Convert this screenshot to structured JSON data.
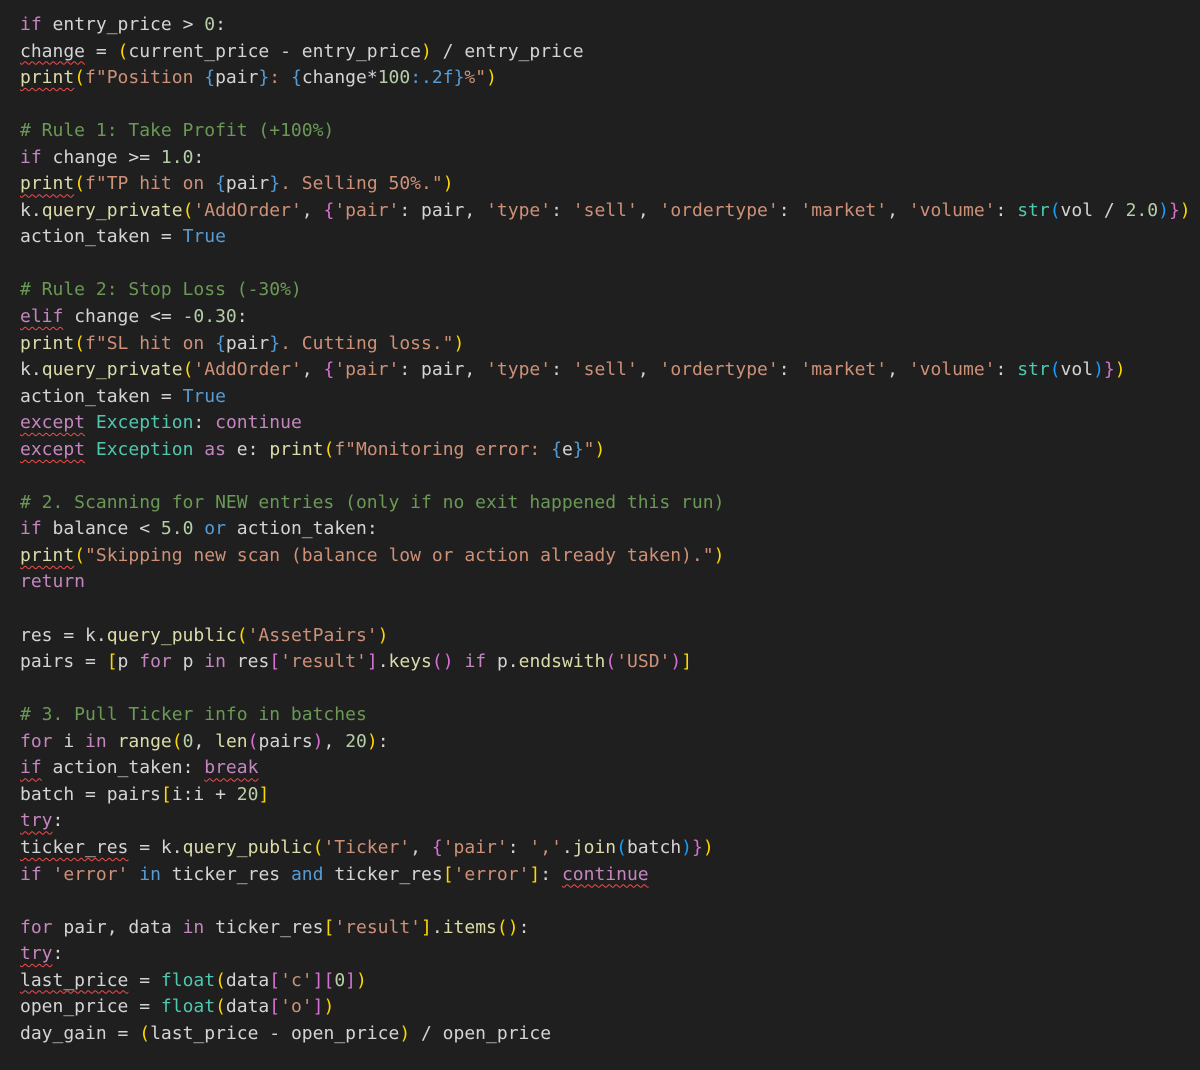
{
  "theme": {
    "background": "#1f1f1f",
    "colors": {
      "text": "#d4d4d4",
      "keyword": "#c586c0",
      "function": "#dcdcaa",
      "string": "#ce9178",
      "number": "#b5cea8",
      "comment": "#6a9955",
      "constant": "#569cd6",
      "type": "#4ec9b0",
      "bracket1": "#ffd700",
      "bracket2": "#da70d6",
      "bracket3": "#179fff",
      "error_squiggle": "#f14c4c"
    }
  },
  "code_lines": [
    [
      [
        "if",
        "keyword"
      ],
      [
        " entry_price > ",
        "text"
      ],
      [
        "0",
        "number"
      ],
      [
        ":",
        "text"
      ]
    ],
    [
      [
        "change",
        "text",
        1
      ],
      [
        " = ",
        "text"
      ],
      [
        "(",
        "bracket1"
      ],
      [
        "current_price - entry_price",
        "text"
      ],
      [
        ")",
        "bracket1"
      ],
      [
        " / entry_price",
        "text"
      ]
    ],
    [
      [
        "print",
        "function",
        1
      ],
      [
        "(",
        "bracket1"
      ],
      [
        "f\"Position ",
        "string"
      ],
      [
        "{",
        "constant"
      ],
      [
        "pair",
        "text"
      ],
      [
        "}",
        "constant"
      ],
      [
        ": ",
        "string"
      ],
      [
        "{",
        "constant"
      ],
      [
        "change*",
        "text"
      ],
      [
        "100",
        "number"
      ],
      [
        ":.2f",
        "constant"
      ],
      [
        "}",
        "constant"
      ],
      [
        "%\"",
        "string"
      ],
      [
        ")",
        "bracket1"
      ]
    ],
    [],
    [
      [
        "# Rule 1: Take Profit (+100%)",
        "comment"
      ]
    ],
    [
      [
        "if",
        "keyword"
      ],
      [
        " change >= ",
        "text"
      ],
      [
        "1.0",
        "number"
      ],
      [
        ":",
        "text"
      ]
    ],
    [
      [
        "print",
        "function",
        1
      ],
      [
        "(",
        "bracket1"
      ],
      [
        "f\"TP hit on ",
        "string"
      ],
      [
        "{",
        "constant"
      ],
      [
        "pair",
        "text"
      ],
      [
        "}",
        "constant"
      ],
      [
        ". Selling 50%.\"",
        "string"
      ],
      [
        ")",
        "bracket1"
      ]
    ],
    [
      [
        "k.",
        "text"
      ],
      [
        "query_private",
        "function"
      ],
      [
        "(",
        "bracket1"
      ],
      [
        "'AddOrder'",
        "string"
      ],
      [
        ", ",
        "text"
      ],
      [
        "{",
        "bracket2"
      ],
      [
        "'pair'",
        "string"
      ],
      [
        ": pair, ",
        "text"
      ],
      [
        "'type'",
        "string"
      ],
      [
        ": ",
        "text"
      ],
      [
        "'sell'",
        "string"
      ],
      [
        ", ",
        "text"
      ],
      [
        "'ordertype'",
        "string"
      ],
      [
        ": ",
        "text"
      ],
      [
        "'market'",
        "string"
      ],
      [
        ", ",
        "text"
      ],
      [
        "'volume'",
        "string"
      ],
      [
        ": ",
        "text"
      ],
      [
        "str",
        "type"
      ],
      [
        "(",
        "bracket3"
      ],
      [
        "vol / ",
        "text"
      ],
      [
        "2.0",
        "number"
      ],
      [
        ")",
        "bracket3"
      ],
      [
        "}",
        "bracket2"
      ],
      [
        ")",
        "bracket1"
      ]
    ],
    [
      [
        "action_taken = ",
        "text"
      ],
      [
        "True",
        "constant"
      ]
    ],
    [],
    [
      [
        "# Rule 2: Stop Loss (-30%)",
        "comment"
      ]
    ],
    [
      [
        "elif",
        "keyword",
        1
      ],
      [
        " change <= ",
        "text"
      ],
      [
        "-0.30",
        "number"
      ],
      [
        ":",
        "text"
      ]
    ],
    [
      [
        "print",
        "function"
      ],
      [
        "(",
        "bracket1"
      ],
      [
        "f\"SL hit on ",
        "string"
      ],
      [
        "{",
        "constant"
      ],
      [
        "pair",
        "text"
      ],
      [
        "}",
        "constant"
      ],
      [
        ". Cutting loss.\"",
        "string"
      ],
      [
        ")",
        "bracket1"
      ]
    ],
    [
      [
        "k.",
        "text"
      ],
      [
        "query_private",
        "function"
      ],
      [
        "(",
        "bracket1"
      ],
      [
        "'AddOrder'",
        "string"
      ],
      [
        ", ",
        "text"
      ],
      [
        "{",
        "bracket2"
      ],
      [
        "'pair'",
        "string"
      ],
      [
        ": pair, ",
        "text"
      ],
      [
        "'type'",
        "string"
      ],
      [
        ": ",
        "text"
      ],
      [
        "'sell'",
        "string"
      ],
      [
        ", ",
        "text"
      ],
      [
        "'ordertype'",
        "string"
      ],
      [
        ": ",
        "text"
      ],
      [
        "'market'",
        "string"
      ],
      [
        ", ",
        "text"
      ],
      [
        "'volume'",
        "string"
      ],
      [
        ": ",
        "text"
      ],
      [
        "str",
        "type"
      ],
      [
        "(",
        "bracket3"
      ],
      [
        "vol",
        "text"
      ],
      [
        ")",
        "bracket3"
      ],
      [
        "}",
        "bracket2"
      ],
      [
        ")",
        "bracket1"
      ]
    ],
    [
      [
        "action_taken = ",
        "text"
      ],
      [
        "True",
        "constant"
      ]
    ],
    [
      [
        "except",
        "keyword",
        1
      ],
      [
        " ",
        "text"
      ],
      [
        "Exception",
        "type"
      ],
      [
        ": ",
        "text"
      ],
      [
        "continue",
        "keyword"
      ]
    ],
    [
      [
        "except",
        "keyword",
        1
      ],
      [
        " ",
        "text"
      ],
      [
        "Exception",
        "type"
      ],
      [
        " ",
        "text"
      ],
      [
        "as",
        "keyword"
      ],
      [
        " e: ",
        "text"
      ],
      [
        "print",
        "function"
      ],
      [
        "(",
        "bracket1"
      ],
      [
        "f\"Monitoring error: ",
        "string"
      ],
      [
        "{",
        "constant"
      ],
      [
        "e",
        "text"
      ],
      [
        "}",
        "constant"
      ],
      [
        "\"",
        "string"
      ],
      [
        ")",
        "bracket1"
      ]
    ],
    [],
    [
      [
        "# 2. Scanning for NEW entries (only if no exit happened this run)",
        "comment"
      ]
    ],
    [
      [
        "if",
        "keyword"
      ],
      [
        " balance < ",
        "text"
      ],
      [
        "5.0",
        "number"
      ],
      [
        " ",
        "text"
      ],
      [
        "or",
        "constant"
      ],
      [
        " action_taken:",
        "text"
      ]
    ],
    [
      [
        "print",
        "function",
        1
      ],
      [
        "(",
        "bracket1"
      ],
      [
        "\"Skipping new scan (balance low or action already taken).\"",
        "string"
      ],
      [
        ")",
        "bracket1"
      ]
    ],
    [
      [
        "return",
        "keyword"
      ]
    ],
    [],
    [
      [
        "res = k.",
        "text"
      ],
      [
        "query_public",
        "function"
      ],
      [
        "(",
        "bracket1"
      ],
      [
        "'AssetPairs'",
        "string"
      ],
      [
        ")",
        "bracket1"
      ]
    ],
    [
      [
        "pairs = ",
        "text"
      ],
      [
        "[",
        "bracket1"
      ],
      [
        "p ",
        "text"
      ],
      [
        "for",
        "keyword"
      ],
      [
        " p ",
        "text"
      ],
      [
        "in",
        "keyword"
      ],
      [
        " res",
        "text"
      ],
      [
        "[",
        "bracket2"
      ],
      [
        "'result'",
        "string"
      ],
      [
        "]",
        "bracket2"
      ],
      [
        ".",
        "text"
      ],
      [
        "keys",
        "function"
      ],
      [
        "()",
        "bracket2"
      ],
      [
        " ",
        "text"
      ],
      [
        "if",
        "keyword"
      ],
      [
        " p.",
        "text"
      ],
      [
        "endswith",
        "function"
      ],
      [
        "(",
        "bracket2"
      ],
      [
        "'USD'",
        "string"
      ],
      [
        ")",
        "bracket2"
      ],
      [
        "]",
        "bracket1"
      ]
    ],
    [],
    [
      [
        "# 3. Pull Ticker info in batches",
        "comment"
      ]
    ],
    [
      [
        "for",
        "keyword"
      ],
      [
        " i ",
        "text"
      ],
      [
        "in",
        "keyword"
      ],
      [
        " ",
        "text"
      ],
      [
        "range",
        "function"
      ],
      [
        "(",
        "bracket1"
      ],
      [
        "0",
        "number"
      ],
      [
        ", ",
        "text"
      ],
      [
        "len",
        "function"
      ],
      [
        "(",
        "bracket2"
      ],
      [
        "pairs",
        "text"
      ],
      [
        ")",
        "bracket2"
      ],
      [
        ", ",
        "text"
      ],
      [
        "20",
        "number"
      ],
      [
        ")",
        "bracket1"
      ],
      [
        ":",
        "text"
      ]
    ],
    [
      [
        "if",
        "keyword",
        1
      ],
      [
        " action_taken: ",
        "text"
      ],
      [
        "break",
        "keyword",
        1
      ]
    ],
    [
      [
        "batch = pairs",
        "text"
      ],
      [
        "[",
        "bracket1"
      ],
      [
        "i:i + ",
        "text"
      ],
      [
        "20",
        "number"
      ],
      [
        "]",
        "bracket1"
      ]
    ],
    [
      [
        "try",
        "keyword",
        1
      ],
      [
        ":",
        "text"
      ]
    ],
    [
      [
        "ticker_res",
        "text",
        1
      ],
      [
        " = k.",
        "text"
      ],
      [
        "query_public",
        "function"
      ],
      [
        "(",
        "bracket1"
      ],
      [
        "'Ticker'",
        "string"
      ],
      [
        ", ",
        "text"
      ],
      [
        "{",
        "bracket2"
      ],
      [
        "'pair'",
        "string"
      ],
      [
        ": ",
        "text"
      ],
      [
        "','",
        "string"
      ],
      [
        ".",
        "text"
      ],
      [
        "join",
        "function"
      ],
      [
        "(",
        "bracket3"
      ],
      [
        "batch",
        "text"
      ],
      [
        ")",
        "bracket3"
      ],
      [
        "}",
        "bracket2"
      ],
      [
        ")",
        "bracket1"
      ]
    ],
    [
      [
        "if",
        "keyword"
      ],
      [
        " ",
        "text"
      ],
      [
        "'error'",
        "string"
      ],
      [
        " ",
        "text"
      ],
      [
        "in",
        "constant"
      ],
      [
        " ticker_res ",
        "text"
      ],
      [
        "and",
        "constant"
      ],
      [
        " ticker_res",
        "text"
      ],
      [
        "[",
        "bracket1"
      ],
      [
        "'error'",
        "string"
      ],
      [
        "]",
        "bracket1"
      ],
      [
        ": ",
        "text"
      ],
      [
        "continue",
        "keyword",
        1
      ]
    ],
    [],
    [
      [
        "for",
        "keyword"
      ],
      [
        " pair, data ",
        "text"
      ],
      [
        "in",
        "keyword"
      ],
      [
        " ticker_res",
        "text"
      ],
      [
        "[",
        "bracket1"
      ],
      [
        "'result'",
        "string"
      ],
      [
        "]",
        "bracket1"
      ],
      [
        ".",
        "text"
      ],
      [
        "items",
        "function"
      ],
      [
        "()",
        "bracket1"
      ],
      [
        ":",
        "text"
      ]
    ],
    [
      [
        "try",
        "keyword",
        1
      ],
      [
        ":",
        "text"
      ]
    ],
    [
      [
        "last_price",
        "text",
        1
      ],
      [
        " = ",
        "text"
      ],
      [
        "float",
        "type"
      ],
      [
        "(",
        "bracket1"
      ],
      [
        "data",
        "text"
      ],
      [
        "[",
        "bracket2"
      ],
      [
        "'c'",
        "string"
      ],
      [
        "]",
        "bracket2"
      ],
      [
        "[",
        "bracket2"
      ],
      [
        "0",
        "number"
      ],
      [
        "]",
        "bracket2"
      ],
      [
        ")",
        "bracket1"
      ]
    ],
    [
      [
        "open_price = ",
        "text"
      ],
      [
        "float",
        "type"
      ],
      [
        "(",
        "bracket1"
      ],
      [
        "data",
        "text"
      ],
      [
        "[",
        "bracket2"
      ],
      [
        "'o'",
        "string"
      ],
      [
        "]",
        "bracket2"
      ],
      [
        ")",
        "bracket1"
      ]
    ],
    [
      [
        "day_gain = ",
        "text"
      ],
      [
        "(",
        "bracket1"
      ],
      [
        "last_price - open_price",
        "text"
      ],
      [
        ")",
        "bracket1"
      ],
      [
        " / open_price",
        "text"
      ]
    ]
  ]
}
